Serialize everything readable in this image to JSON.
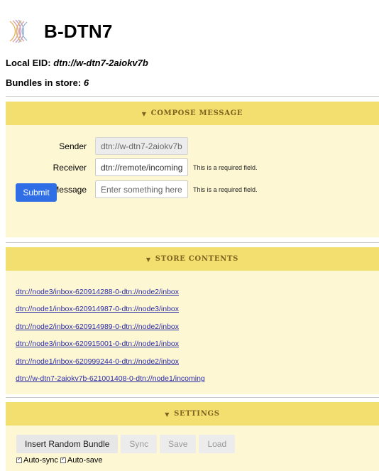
{
  "app": {
    "title": "B-DTN7"
  },
  "info": {
    "eid_label": "Local EID:",
    "eid_value": "dtn://w-dtn7-2aiokv7b",
    "bundles_label": "Bundles in store:",
    "bundles_value": "6"
  },
  "compose": {
    "heading": "COMPOSE MESSAGE",
    "sender_label": "Sender",
    "sender_value": "dtn://w-dtn7-2aiokv7b",
    "receiver_label": "Receiver",
    "receiver_value": "dtn://remote/incoming",
    "receiver_hint": "This is a required field.",
    "message_label": "Message",
    "message_placeholder": "Enter something here...",
    "message_hint": "This is a required field.",
    "submit_label": "Submit"
  },
  "store": {
    "heading": "STORE CONTENTS",
    "items": [
      "dtn://node3/inbox-620914288-0-dtn://node2/inbox",
      "dtn://node1/inbox-620914987-0-dtn://node3/inbox",
      "dtn://node2/inbox-620914989-0-dtn://node2/inbox",
      "dtn://node3/inbox-620915001-0-dtn://node1/inbox",
      "dtn://node1/inbox-620999244-0-dtn://node2/inbox",
      "dtn://w-dtn7-2aiokv7b-621001408-0-dtn://node1/incoming"
    ]
  },
  "settings": {
    "heading": "SETTINGS",
    "insert_label": "Insert Random Bundle",
    "sync_label": "Sync",
    "save_label": "Save",
    "load_label": "Load",
    "autosync_label": "Auto-sync",
    "autosave_label": "Auto-save"
  },
  "colors": {
    "panel_header": "#f3de70",
    "panel_body": "#fdf7d4",
    "header_text": "#7d6220",
    "primary_button": "#2f6ee5",
    "link": "#2a2aa8"
  }
}
